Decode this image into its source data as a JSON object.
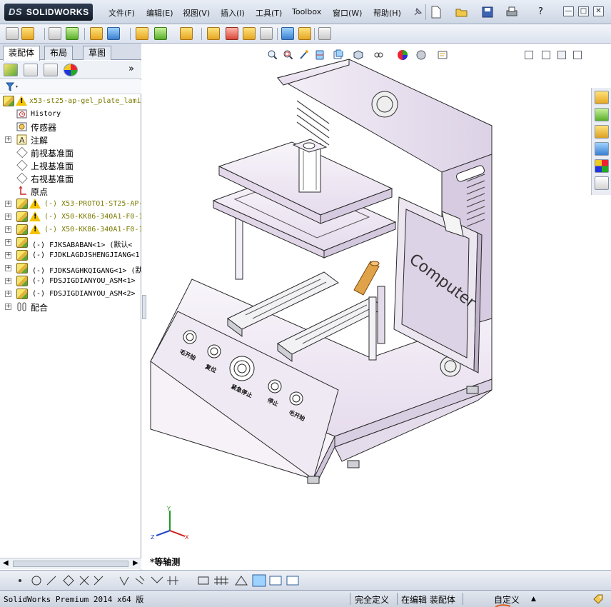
{
  "app": {
    "logo_ds": "DS",
    "logo_name": "SOLIDWORKS"
  },
  "menu": [
    {
      "label": "文件(F)"
    },
    {
      "label": "编辑(E)"
    },
    {
      "label": "视图(V)"
    },
    {
      "label": "插入(I)"
    },
    {
      "label": "工具(T)"
    },
    {
      "label": "Toolbox"
    },
    {
      "label": "窗口(W)"
    },
    {
      "label": "帮助(H)"
    }
  ],
  "window_controls": {
    "help": "?",
    "minimize": "—",
    "restore": "□",
    "close": "✕"
  },
  "tabs": [
    {
      "label": "装配体",
      "active": true
    },
    {
      "label": "布局",
      "active": false
    },
    {
      "label": "草图",
      "active": false
    }
  ],
  "feature_manager": {
    "expand_more": "»",
    "filter_icon": "filter-icon",
    "root": "x53-st25-ap-gel_plate_lami",
    "items": [
      {
        "label": "History",
        "icon": "history-icon",
        "mono": true
      },
      {
        "label": "传感器",
        "icon": "sensor-icon"
      },
      {
        "label": "注解",
        "icon": "annotation-icon",
        "expander": "+"
      },
      {
        "label": "前视基准面",
        "icon": "plane-icon"
      },
      {
        "label": "上视基准面",
        "icon": "plane-icon"
      },
      {
        "label": "右视基准面",
        "icon": "plane-icon"
      },
      {
        "label": "原点",
        "icon": "origin-icon"
      },
      {
        "label": "(-) X53-PROTO1-ST25-AP-",
        "icon": "assembly-icon",
        "warning": true,
        "expander": "+"
      },
      {
        "label": "(-) X50-KK86-340A1-F0-1",
        "icon": "assembly-icon",
        "warning": true,
        "expander": "+"
      },
      {
        "label": "(-) X50-KK86-340A1-F0-1",
        "icon": "assembly-icon",
        "warning": true,
        "expander": "+"
      },
      {
        "label": "(-) FJKSABABAN<1> (默认<",
        "icon": "assembly-icon",
        "expander": "+"
      },
      {
        "label": "(-) FJDKLAGDJSHENGJIANG<1",
        "icon": "assembly-icon",
        "expander": "+"
      },
      {
        "label": "(-) FJDKSAGHKQIGANG<1> (默",
        "icon": "assembly-icon",
        "expander": "+"
      },
      {
        "label": "(-) FDSJIGDIANYOU_ASM<1>",
        "icon": "assembly-icon",
        "expander": "+"
      },
      {
        "label": "(-) FDSJIGDIANYOU_ASM<2>",
        "icon": "assembly-icon",
        "expander": "+"
      },
      {
        "label": "配合",
        "icon": "mates-icon",
        "expander": "+"
      }
    ]
  },
  "viewport": {
    "view_name": "*等轴测",
    "model_panel_labels": [
      "Computer"
    ],
    "control_labels": [
      "毛开始",
      "复位",
      "紧急停止",
      "停止",
      "毛开始"
    ],
    "triad": {
      "x": "X",
      "y": "Y",
      "z": "Z"
    }
  },
  "status": {
    "product": "SolidWorks Premium 2014 x64 版",
    "constraint": "完全定义",
    "mode": "在编辑 装配体",
    "units": "自定义",
    "units_arrow": "▲"
  },
  "colors": {
    "model_fill": "#ece6f0",
    "model_shade": "#d9cfe2",
    "accent_orange": "#e0a34a"
  }
}
